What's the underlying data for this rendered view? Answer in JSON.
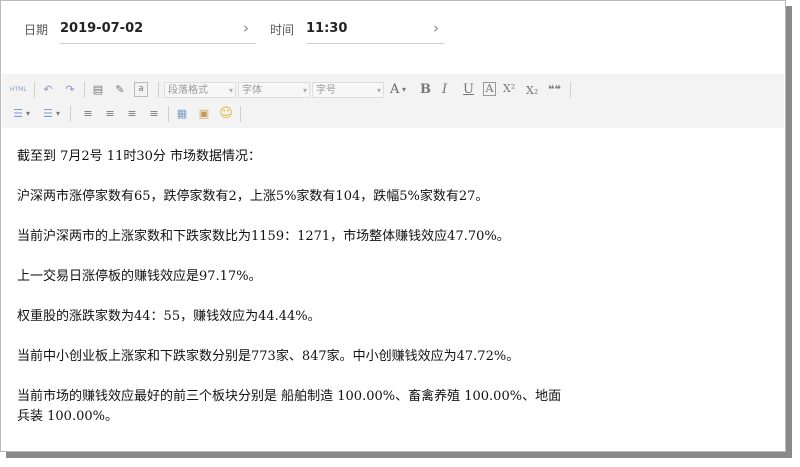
{
  "header": {
    "date_label": "日期",
    "date_value": "2019-07-02",
    "time_label": "时间",
    "time_value": "11:30"
  },
  "toolbar": {
    "html_label": "HTML",
    "paragraph_format": "段落格式",
    "font_family": "字体",
    "font_size": "字号",
    "bold": "B",
    "italic": "I",
    "underline": "U",
    "strike_box": "A",
    "font_color": "A",
    "superscript": "X²",
    "subscript": "X₂",
    "quote": "❝❝",
    "icons": [
      "undo-icon",
      "redo-icon",
      "paste-icon",
      "format-brush-icon",
      "clear-format-icon",
      "ordered-list-icon",
      "unordered-list-icon",
      "align-left-icon",
      "align-center-icon",
      "align-right-icon",
      "align-justify-icon",
      "table-icon",
      "image-icon",
      "emoji-icon"
    ]
  },
  "content": {
    "paragraphs": [
      "截至到 7月2号 11时30分 市场数据情况：",
      "沪深两市涨停家数有65，跌停家数有2，上涨5%家数有104，跌幅5%家数有27。",
      "当前沪深两市的上涨家数和下跌家数比为1159：1271，市场整体赚钱效应47.70%。",
      "上一交易日涨停板的赚钱效应是97.17%。",
      "权重股的涨跌家数为44：55，赚钱效应为44.44%。",
      "当前中小创业板上涨家和下跌家数分别是773家、847家。中小创赚钱效应为47.72%。",
      "当前市场的赚钱效应最好的前三个板块分别是 船舶制造 100.00%、畜禽养殖 100.00%、地面",
      "兵装 100.00%。"
    ]
  }
}
